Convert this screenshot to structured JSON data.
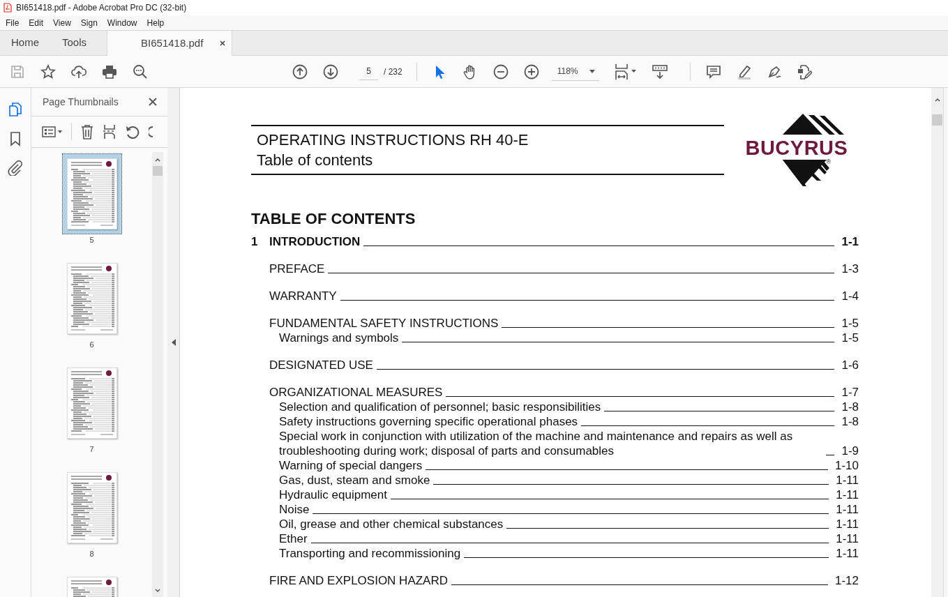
{
  "window": {
    "title": "BI651418.pdf - Adobe Acrobat Pro DC (32-bit)"
  },
  "menu": [
    "File",
    "Edit",
    "View",
    "Sign",
    "Window",
    "Help"
  ],
  "tabs": [
    {
      "label": "Home",
      "selected": false
    },
    {
      "label": "Tools",
      "selected": false
    },
    {
      "label": "BI651418.pdf",
      "selected": true
    }
  ],
  "toolbar": {
    "buttons": [
      {
        "kind": "save",
        "disabled": true
      },
      {
        "kind": "star",
        "disabled": false
      },
      {
        "kind": "upload",
        "disabled": false
      },
      {
        "kind": "print",
        "disabled": false
      },
      {
        "kind": "find",
        "disabled": false
      }
    ],
    "page_number": "5",
    "page_count": "/ 232",
    "tools": [
      {
        "kind": "select",
        "selected": true
      },
      {
        "kind": "hand",
        "selected": false
      }
    ],
    "zoom": "118%"
  },
  "side_rail": [
    {
      "kind": "pages",
      "selected": true
    },
    {
      "kind": "bookmark",
      "selected": false
    },
    {
      "kind": "attachment",
      "selected": false
    }
  ],
  "thumbnails_panel": {
    "title": "Page Thumbnails",
    "pages": [
      {
        "label": "5",
        "selected": true
      },
      {
        "label": "6",
        "selected": false
      },
      {
        "label": "7",
        "selected": false
      },
      {
        "label": "8",
        "selected": false
      },
      {
        "selected": false
      }
    ]
  },
  "document": {
    "header": [
      "OPERATING INSTRUCTIONS RH 40-E",
      "Table of contents"
    ],
    "logo": {
      "text": "BUCYRUS",
      "mark": "®"
    },
    "heading": "TABLE OF CONTENTS",
    "toc": [
      {
        "kind": "chapter",
        "number": "1",
        "title": "INTRODUCTION",
        "page": "1-1"
      },
      {
        "kind": "section",
        "title": "PREFACE",
        "page": "1-3"
      },
      {
        "kind": "section",
        "title": "WARRANTY",
        "page": "1-4"
      },
      {
        "kind": "section",
        "title": "FUNDAMENTAL SAFETY INSTRUCTIONS",
        "page": "1-5",
        "children": [
          {
            "title": "Warnings and symbols",
            "page": "1-5"
          }
        ]
      },
      {
        "kind": "section",
        "title": "DESIGNATED USE",
        "page": "1-6"
      },
      {
        "kind": "section",
        "title": "ORGANIZATIONAL MEASURES",
        "page": "1-7",
        "children": [
          {
            "title": "Selection and qualification of personnel; basic responsibilities",
            "page": "1-8"
          },
          {
            "title": "Safety instructions governing specific operational phases",
            "page": "1-8"
          },
          {
            "title": "Special work in conjunction with utilization of the machine and maintenance and repairs as well as troubleshooting during work; disposal of parts and consumables",
            "page": "1-9"
          },
          {
            "title": "Warning of special dangers",
            "page": "1-10"
          },
          {
            "title": "Gas, dust, steam and smoke",
            "page": "1-11"
          },
          {
            "title": "Hydraulic equipment",
            "page": "1-11"
          },
          {
            "title": "Noise",
            "page": "1-11"
          },
          {
            "title": "Oil, grease and other chemical substances",
            "page": "1-11"
          },
          {
            "title": "Ether",
            "page": "1-11"
          },
          {
            "title": "Transporting and recommissioning",
            "page": "1-11"
          }
        ]
      },
      {
        "kind": "section",
        "title": "FIRE AND EXPLOSION HAZARD",
        "page": "1-12"
      }
    ]
  }
}
